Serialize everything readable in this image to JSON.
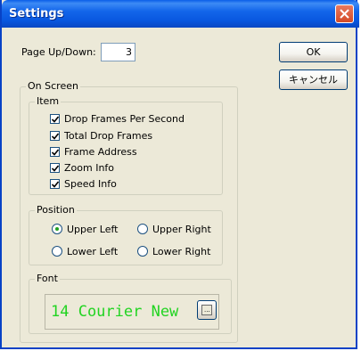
{
  "window": {
    "title": "Settings"
  },
  "page_updown": {
    "label": "Page Up/Down:",
    "value": "3"
  },
  "buttons": {
    "ok": "OK",
    "cancel": "キャンセル"
  },
  "on_screen": {
    "label": "On Screen",
    "item": {
      "label": "Item",
      "checkboxes": [
        {
          "label": "Drop Frames Per Second",
          "checked": true
        },
        {
          "label": "Total Drop Frames",
          "checked": true
        },
        {
          "label": "Frame Address",
          "checked": true
        },
        {
          "label": "Zoom Info",
          "checked": true
        },
        {
          "label": "Speed Info",
          "checked": true
        }
      ]
    },
    "position": {
      "label": "Position",
      "options": [
        {
          "label": "Upper Left",
          "selected": true
        },
        {
          "label": "Upper Right",
          "selected": false
        },
        {
          "label": "Lower Left",
          "selected": false
        },
        {
          "label": "Lower Right",
          "selected": false
        }
      ]
    },
    "font": {
      "label": "Font",
      "preview": "14 Courier New",
      "preview_color": "#22d422",
      "browse_button": "..."
    }
  },
  "colors": {
    "titlebar": "#0a5ee8",
    "window_bg": "#ece9d8",
    "close_button": "#d44a25"
  }
}
